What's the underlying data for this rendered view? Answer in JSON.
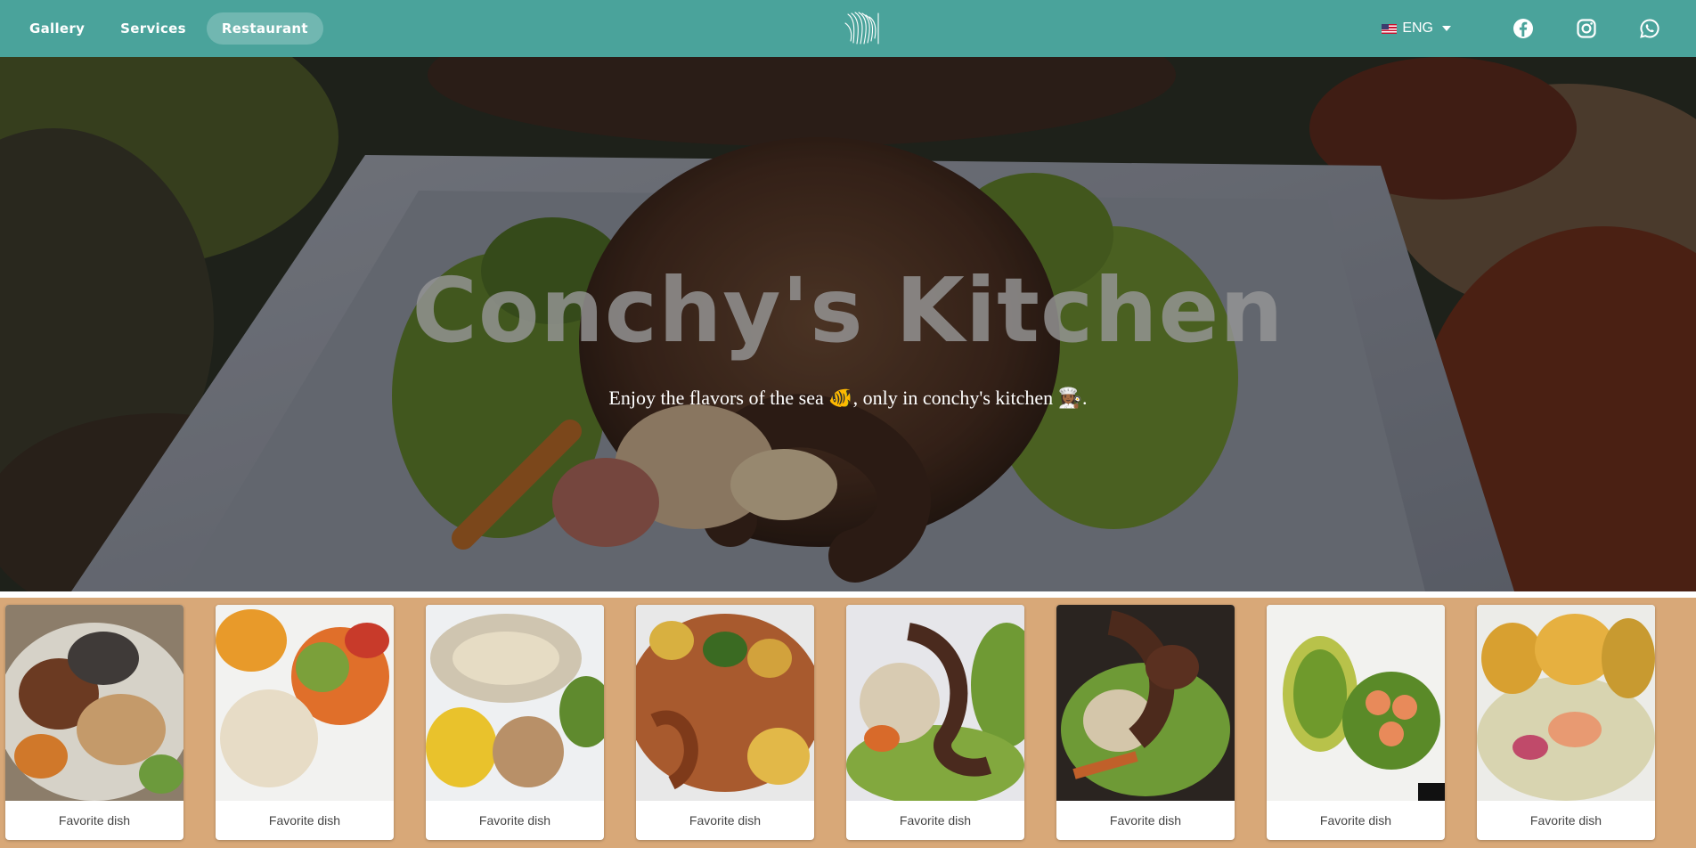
{
  "nav": {
    "links": [
      {
        "label": "Gallery"
      },
      {
        "label": "Services"
      },
      {
        "label": "Restaurant",
        "active": true
      }
    ],
    "language": {
      "label": "ENG",
      "flag": "us-flag"
    },
    "social_icons": [
      "facebook-icon",
      "instagram-icon",
      "whatsapp-icon"
    ],
    "logo": "palm-leaf-logo"
  },
  "hero": {
    "title": "Conchy's Kitchen",
    "subtitle": "Enjoy the flavors of the sea 🐠, only in conchy's kitchen 👩🏾‍🍳."
  },
  "dishes": [
    {
      "label": "Favorite dish"
    },
    {
      "label": "Favorite dish"
    },
    {
      "label": "Favorite dish"
    },
    {
      "label": "Favorite dish"
    },
    {
      "label": "Favorite dish"
    },
    {
      "label": "Favorite dish"
    },
    {
      "label": "Favorite dish"
    },
    {
      "label": "Favorite dish"
    }
  ],
  "colors": {
    "nav": "#4aa39b",
    "dish_strip": "#d8a878",
    "hero_title": "#969696"
  }
}
